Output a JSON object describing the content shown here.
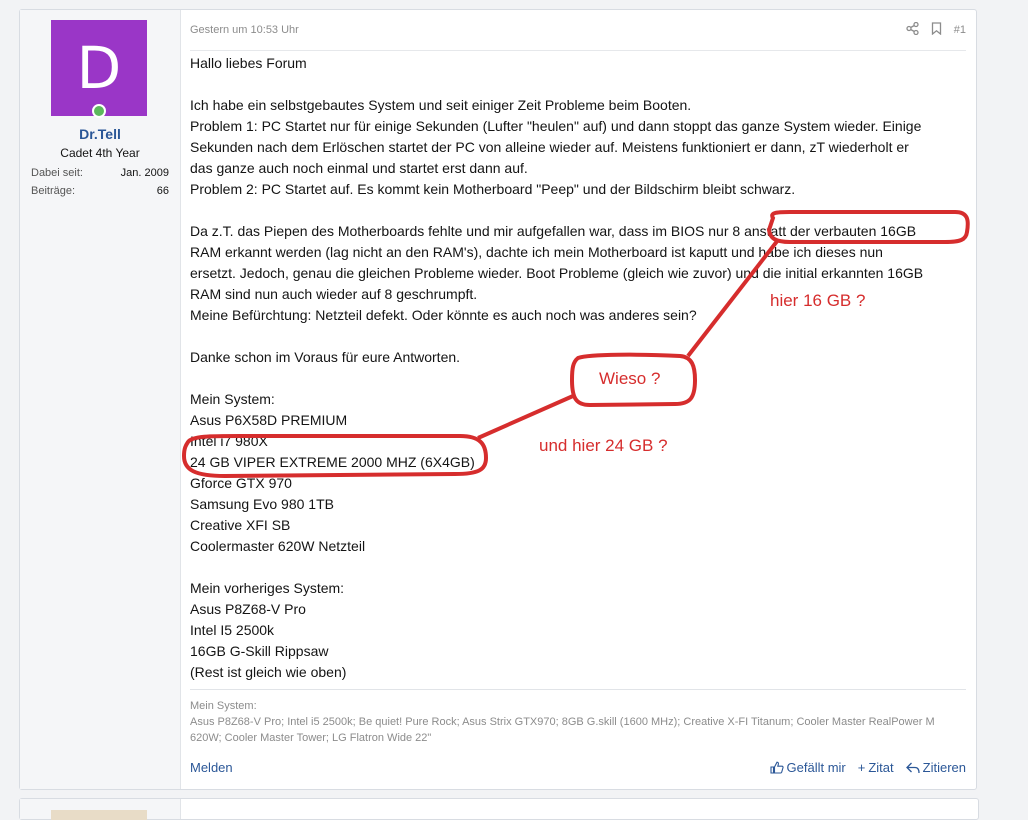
{
  "user": {
    "avatar_letter": "D",
    "name": "Dr.Tell",
    "title": "Cadet 4th Year",
    "stats": [
      {
        "label": "Dabei seit:",
        "value": "Jan. 2009"
      },
      {
        "label": "Beiträge:",
        "value": "66"
      }
    ]
  },
  "post": {
    "date": "Gestern um 10:53 Uhr",
    "number": "#1",
    "lines": [
      "Hallo liebes Forum",
      "",
      "Ich habe ein selbstgebautes System und seit einiger Zeit Probleme beim Booten.",
      "Problem 1: PC Startet nur für einige Sekunden (Lufter \"heulen\" auf) und dann stoppt das ganze System wieder. Einige",
      "Sekunden nach dem Erlöschen startet der PC von alleine wieder auf. Meistens funktioniert er dann, zT wiederholt er",
      "das ganze auch noch einmal und startet erst dann auf.",
      "Problem 2: PC Startet auf. Es kommt kein Motherboard \"Peep\" und der Bildschirm bleibt schwarz.",
      "",
      "Da z.T. das Piepen des Motherboards fehlte und mir aufgefallen war, dass im BIOS nur 8 anstatt der verbauten 16GB",
      "RAM erkannt werden (lag nicht an den RAM's), dachte ich mein Motherboard ist kaputt und habe ich dieses nun",
      "ersetzt. Jedoch, genau die gleichen Probleme wieder. Boot Probleme (gleich wie zuvor) und die initial erkannten 16GB",
      "RAM sind nun auch wieder auf 8 geschrumpft.",
      "Meine Befürchtung: Netzteil defekt. Oder könnte es auch noch was anderes sein?",
      "",
      "Danke schon im Voraus für eure Antworten.",
      "",
      "Mein System:",
      "Asus P6X58D PREMIUM",
      "Intel i7 980X",
      "24 GB VIPER EXTREME 2000 MHZ (6X4GB)",
      "Gforce GTX 970",
      "Samsung Evo 980 1TB",
      "Creative XFI SB",
      "Coolermaster 620W Netzteil",
      "",
      "Mein vorheriges System:",
      "Asus P8Z68-V Pro",
      "Intel I5 2500k",
      "16GB G-Skill Rippsaw",
      "(Rest ist gleich wie oben)"
    ],
    "signature": {
      "heading": "Mein System:",
      "line1": "Asus P8Z68-V Pro; Intel i5 2500k; Be quiet! Pure Rock; Asus Strix GTX970; 8GB G.skill (1600 MHz); Creative X-FI Titanum; Cooler Master RealPower M",
      "line2": "620W; Cooler Master Tower; LG Flatron Wide 22\""
    }
  },
  "footer": {
    "report": "Melden",
    "like": "Gefällt mir",
    "quote": "Zitat",
    "reply": "Zitieren"
  },
  "annotations": {
    "top_right": "hier 16 GB ?",
    "middle": "Wieso ?",
    "bottom": "und hier 24 GB ?"
  },
  "colors": {
    "avatar_bg": "#9a36c7",
    "link": "#2b5797",
    "annotation": "#d62d2d"
  },
  "icons": [
    "share-icon",
    "bookmark-icon",
    "thumbs-up-icon",
    "plus-icon",
    "reply-icon"
  ]
}
